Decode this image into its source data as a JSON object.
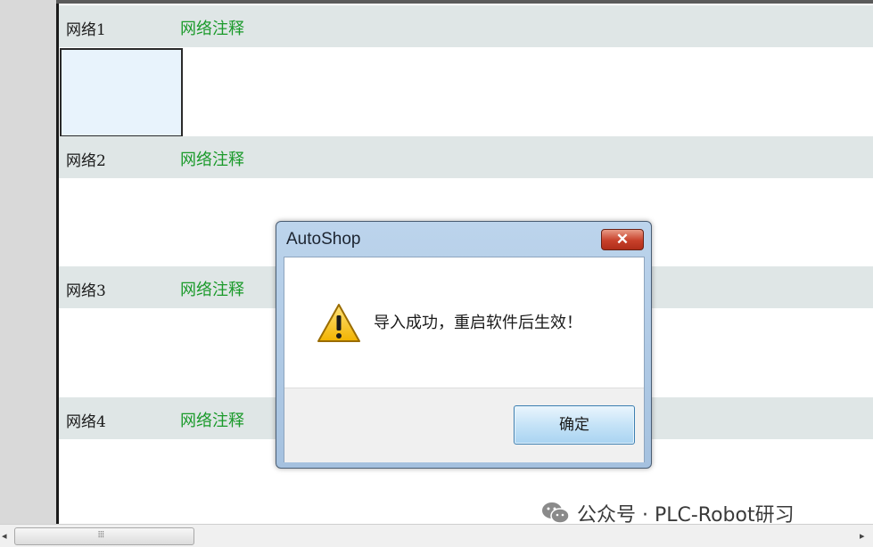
{
  "networks": [
    {
      "name": "网络1",
      "comment": "网络注释"
    },
    {
      "name": "网络2",
      "comment": "网络注释"
    },
    {
      "name": "网络3",
      "comment": "网络注释"
    },
    {
      "name": "网络4",
      "comment": "网络注释"
    }
  ],
  "dialog": {
    "title": "AutoShop",
    "close_label": "✕",
    "message": "导入成功，重启软件后生效！",
    "ok_label": "确定",
    "icon": "warning-icon"
  },
  "scrollbar": {
    "left_arrow": "◂",
    "right_arrow": "▸",
    "grip": "⦙⦙⦙"
  },
  "watermark": {
    "text": "公众号 · PLC-Robot研习",
    "icon": "wechat-icon"
  }
}
